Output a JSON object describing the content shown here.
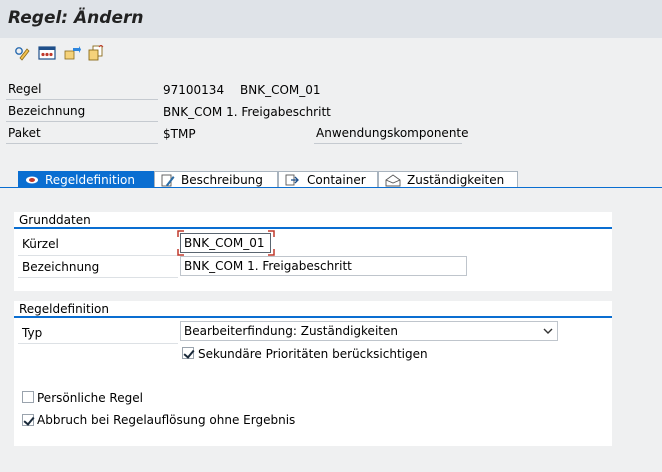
{
  "window": {
    "title": "Regel: Ändern"
  },
  "toolbar": {
    "buttons": [
      {
        "icon": "edit-pencil-icon"
      },
      {
        "icon": "simulate-icon"
      },
      {
        "icon": "transport-icon"
      },
      {
        "icon": "copy-icon"
      }
    ]
  },
  "header": {
    "regel_label": "Regel",
    "regel_id": "97100134",
    "regel_name": "BNK_COM_01",
    "bezeichnung_label": "Bezeichnung",
    "bezeichnung_value": "BNK_COM 1. Freigabeschritt",
    "paket_label": "Paket",
    "paket_value": "$TMP",
    "anwendungskomponente_label": "Anwendungskomponente"
  },
  "tabs": [
    {
      "label": "Regeldefinition",
      "active": true,
      "icon": "rule-icon"
    },
    {
      "label": "Beschreibung",
      "active": false,
      "icon": "description-icon"
    },
    {
      "label": "Container",
      "active": false,
      "icon": "container-icon"
    },
    {
      "label": "Zuständigkeiten",
      "active": false,
      "icon": "responsibility-icon"
    }
  ],
  "grunddaten": {
    "title": "Grunddaten",
    "kuerzel_label": "Kürzel",
    "kuerzel_value": "BNK_COM_01",
    "bezeichnung_label": "Bezeichnung",
    "bezeichnung_value": "BNK_COM 1. Freigabeschritt"
  },
  "regeldefinition": {
    "title": "Regeldefinition",
    "typ_label": "Typ",
    "typ_value": "Bearbeiterfindung: Zuständigkeiten",
    "sekundaer_label": "Sekundäre Prioritäten berücksichtigen",
    "sekundaer_checked": true,
    "persoenlich_label": "Persönliche Regel",
    "persoenlich_checked": false,
    "abbruch_label": "Abbruch bei Regelauflösung ohne Ergebnis",
    "abbruch_checked": true
  },
  "colors": {
    "accent": "#0a6ed1",
    "title_bar": "#dfe3e8",
    "background": "#eff0f1"
  }
}
